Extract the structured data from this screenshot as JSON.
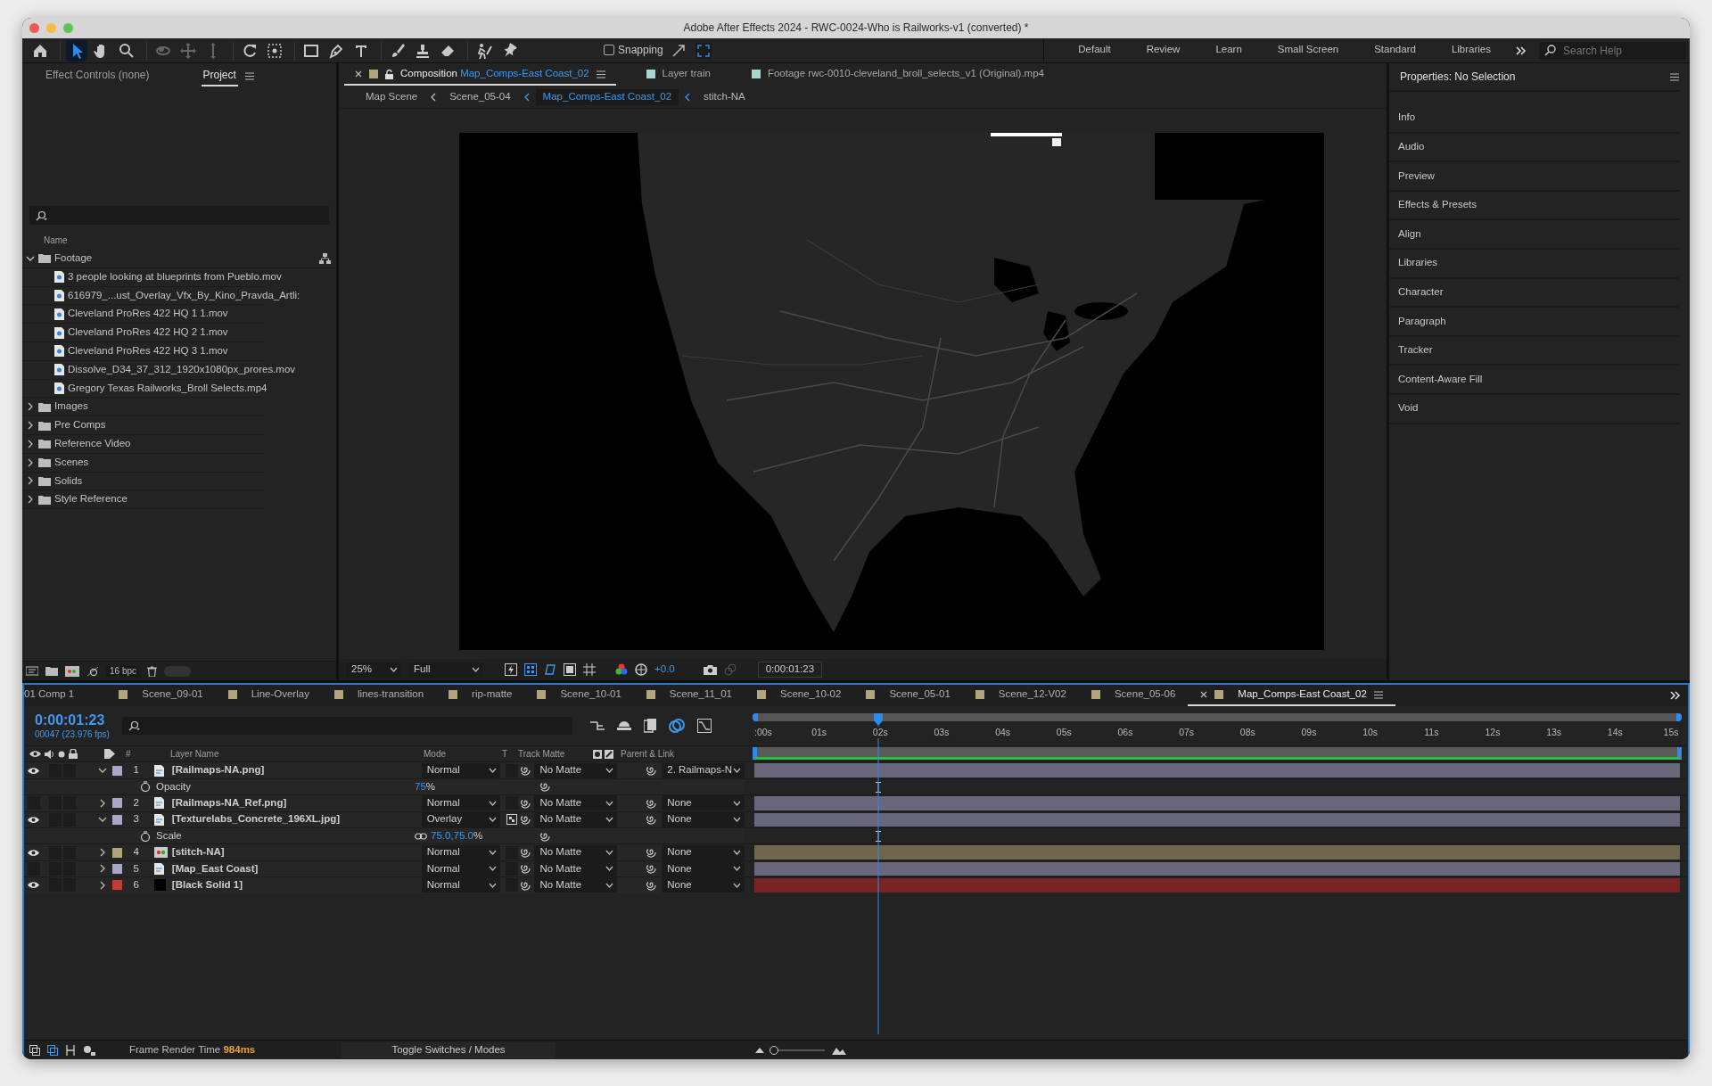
{
  "window": {
    "title": "Adobe After Effects 2024 - RWC-0024-Who is Railworks-v1 (converted) *"
  },
  "toolbar": {
    "tools": [
      {
        "kind": "home",
        "selected": false
      },
      {
        "kind": "select",
        "selected": true
      },
      {
        "kind": "hand",
        "selected": false
      },
      {
        "kind": "zoom",
        "selected": false
      },
      {
        "kind": "orbit",
        "selected": false
      },
      {
        "kind": "pan",
        "selected": false
      },
      {
        "kind": "dolly",
        "selected": false
      },
      {
        "kind": "rotate",
        "selected": false
      },
      {
        "kind": "anchor",
        "selected": false
      },
      {
        "kind": "rect",
        "selected": false
      },
      {
        "kind": "pen",
        "selected": false
      },
      {
        "kind": "type",
        "selected": false
      },
      {
        "kind": "brush",
        "selected": false
      },
      {
        "kind": "stamp",
        "selected": false
      },
      {
        "kind": "eraser",
        "selected": false
      },
      {
        "kind": "roto",
        "selected": false
      },
      {
        "kind": "pin",
        "selected": false
      }
    ],
    "snapping": {
      "label": "Snapping",
      "checked": false
    },
    "workspaces": [
      {
        "label": "Default",
        "selected": false
      },
      {
        "label": "Review",
        "selected": false
      },
      {
        "label": "Learn",
        "selected": false
      },
      {
        "label": "Small Screen",
        "selected": false
      },
      {
        "label": "Standard",
        "selected": false
      },
      {
        "label": "Libraries",
        "selected": false
      }
    ],
    "search": {
      "placeholder": "Search Help"
    }
  },
  "project_panel": {
    "tabs": [
      {
        "label": "Effect Controls (none)",
        "selected": false
      },
      {
        "label": "Project",
        "selected": true
      }
    ],
    "name_column": "Name",
    "tree": [
      {
        "label": "Footage",
        "kind": "folder",
        "expanded": true,
        "children": [
          {
            "label": "3 people looking at blueprints from Pueblo.mov",
            "kind": "file"
          },
          {
            "label": "616979_...ust_Overlay_Vfx_By_Kino_Pravda_Artli:",
            "kind": "file"
          },
          {
            "label": "Cleveland ProRes 422 HQ 1 1.mov",
            "kind": "file"
          },
          {
            "label": "Cleveland ProRes 422 HQ 2 1.mov",
            "kind": "file"
          },
          {
            "label": "Cleveland ProRes 422 HQ 3 1.mov",
            "kind": "file"
          },
          {
            "label": "Dissolve_D34_37_312_1920x1080px_prores.mov",
            "kind": "file"
          },
          {
            "label": "Gregory Texas Railworks_Broll Selects.mp4",
            "kind": "file"
          }
        ]
      },
      {
        "label": "Images",
        "kind": "folder",
        "expanded": false
      },
      {
        "label": "Pre Comps",
        "kind": "folder",
        "expanded": false
      },
      {
        "label": "Reference Video",
        "kind": "folder",
        "expanded": false
      },
      {
        "label": "Scenes",
        "kind": "folder",
        "expanded": false
      },
      {
        "label": "Solids",
        "kind": "folder",
        "expanded": false
      },
      {
        "label": "Style Reference",
        "kind": "folder",
        "expanded": false
      }
    ],
    "bit_depth": "16 bpc",
    "thumbnail_toggle": {
      "on": false
    }
  },
  "viewer": {
    "tabs": [
      {
        "type": "Composition",
        "label": "Map_Comps-East Coast_02",
        "color": "#b4a37f",
        "selected": true
      },
      {
        "type": "Layer",
        "label": "train",
        "color": "#a9d4cf",
        "selected": false
      },
      {
        "type": "Footage",
        "label": "rwc-0010-cleveland_broll_selects_v1 (Original).mp4",
        "color": "#a9d4cf",
        "selected": false
      }
    ],
    "breadcrumbs": [
      {
        "label": "Map Scene",
        "selected": false
      },
      {
        "label": "Scene_05-04",
        "selected": false
      },
      {
        "label": "Map_Comps-East Coast_02",
        "selected": true
      },
      {
        "label": "stitch-NA",
        "selected": false
      }
    ],
    "zoom": "25%",
    "resolution": "Full",
    "exposure": "+0.0",
    "timecode": "0:00:01:23"
  },
  "properties_panel": {
    "title": "Properties: No Selection",
    "panels": [
      "Info",
      "Audio",
      "Preview",
      "Effects & Presets",
      "Align",
      "Libraries",
      "Character",
      "Paragraph",
      "Tracker",
      "Content-Aware Fill",
      "Void"
    ]
  },
  "timeline": {
    "tabs": [
      {
        "label": "01 Comp 1",
        "selected": false
      },
      {
        "label": "Scene_09-01",
        "selected": false
      },
      {
        "label": "Line-Overlay",
        "selected": false
      },
      {
        "label": "lines-transition",
        "selected": false
      },
      {
        "label": "rip-matte",
        "selected": false
      },
      {
        "label": "Scene_10-01",
        "selected": false
      },
      {
        "label": "Scene_11_01",
        "selected": false
      },
      {
        "label": "Scene_10-02",
        "selected": false
      },
      {
        "label": "Scene_05-01",
        "selected": false
      },
      {
        "label": "Scene_12-V02",
        "selected": false
      },
      {
        "label": "Scene_05-06",
        "selected": false
      },
      {
        "label": "Map_Comps-East Coast_02",
        "selected": true
      }
    ],
    "timecode": "0:00:01:23",
    "frame_info": "00047 (23.976 fps)",
    "columns": {
      "number": "#",
      "name": "Layer Name",
      "mode": "Mode",
      "t": "T",
      "matte": "Track Matte",
      "parent": "Parent & Link"
    },
    "ruler": [
      ":00s",
      "01s",
      "02s",
      "03s",
      "04s",
      "05s",
      "06s",
      "07s",
      "08s",
      "09s",
      "10s",
      "11s",
      "12s",
      "13s",
      "14s",
      "15s"
    ],
    "playhead": {
      "level": 0.131
    },
    "layers": [
      {
        "number": "1",
        "name": "[Railmaps-NA.png]",
        "kind": "file",
        "color": "#a9a6c8",
        "visible": true,
        "solo": false,
        "locked": false,
        "expanded": true,
        "mode": "Normal",
        "transparency": false,
        "matte": "No Matte",
        "parent": "2. Railmaps-N",
        "properties": [
          {
            "name": "Opacity",
            "value": "75",
            "unit": "%",
            "linked": false
          }
        ]
      },
      {
        "number": "2",
        "name": "[Railmaps-NA_Ref.png]",
        "kind": "file",
        "color": "#a9a6c8",
        "visible": false,
        "solo": false,
        "locked": false,
        "expanded": false,
        "mode": "Normal",
        "transparency": false,
        "matte": "No Matte",
        "parent": "None"
      },
      {
        "number": "3",
        "name": "[Texturelabs_Concrete_196XL.jpg]",
        "kind": "file",
        "color": "#a9a6c8",
        "visible": true,
        "solo": false,
        "locked": false,
        "expanded": true,
        "mode": "Overlay",
        "transparency": true,
        "matte": "No Matte",
        "parent": "None",
        "properties": [
          {
            "name": "Scale",
            "value": "75.0,75.0",
            "unit": "%",
            "linked": true
          }
        ]
      },
      {
        "number": "4",
        "name": "[stitch-NA]",
        "kind": "comp",
        "color": "#b4a37f",
        "visible": true,
        "solo": false,
        "locked": false,
        "expanded": false,
        "mode": "Normal",
        "transparency": false,
        "matte": "No Matte",
        "parent": "None"
      },
      {
        "number": "5",
        "name": "[Map_East Coast]",
        "kind": "file",
        "color": "#a9a6c8",
        "visible": false,
        "solo": false,
        "locked": false,
        "expanded": false,
        "mode": "Normal",
        "transparency": false,
        "matte": "No Matte",
        "parent": "None"
      },
      {
        "number": "6",
        "name": "[Black Solid 1]",
        "kind": "solid",
        "color": "#c33a3a",
        "visible": true,
        "solo": false,
        "locked": false,
        "expanded": false,
        "mode": "Normal",
        "transparency": false,
        "matte": "No Matte",
        "parent": "None"
      }
    ],
    "footer": {
      "render_label": "Frame Render Time",
      "render_value": "984ms",
      "toggle": "Toggle Switches / Modes",
      "zoom": {
        "level": 0.05
      }
    }
  }
}
